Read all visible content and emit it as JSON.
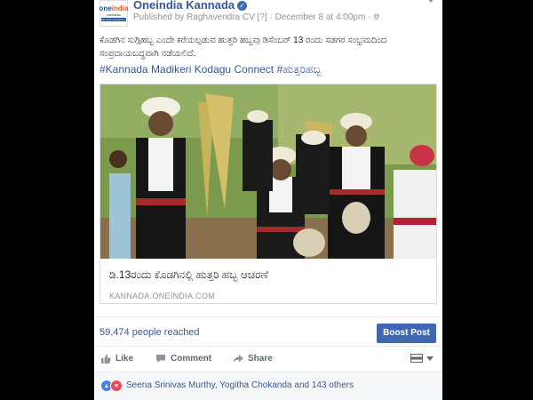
{
  "page": {
    "name": "Oneindia Kannada",
    "logo": {
      "text_a": "one",
      "text_b": "india",
      "sub": "kannada",
      "strip": "kannada.oneindia.com"
    }
  },
  "post": {
    "published_by": "Published by Raghavendra CV",
    "published_marker": "[?]",
    "separator": "·",
    "date": "December 8 at 4:00pm",
    "body": "ಕೊಡಗಿನ ಸುಗ್ಗಿಹಬ್ಬ ಎಂದೇ ಕರೆಯಲ್ಪಡುವ ಹುತ್ತರಿ ಹಬ್ಬವು ಡಿಸೆಂಬರ್ 13 ರಂದು ಸಡಗರ ಸಂಭ್ರಮದಿಂದ ಸಂಪ್ರದಾಯಬದ್ಧವಾಗಿ ನಡೆಯಲಿದೆ.",
    "hashtags": "#Kannada Madikeri Kodagu Connect #ಹುತ್ತರಿಹಬ್ಬ"
  },
  "link_preview": {
    "title": "ಡಿ.13ರಂದು ಕೊಡಗಿನಲ್ಲಿ ಹುತ್ತರಿ ಹಬ್ಬ ಆಚರಣೆ",
    "domain": "KANNADA.ONEINDIA.COM"
  },
  "stats": {
    "reach": "59,474 people reached",
    "boost_label": "Boost Post"
  },
  "actions": {
    "like": "Like",
    "comment": "Comment",
    "share": "Share"
  },
  "reactions": {
    "names": "Seena Srinivas Murthy, Yogitha Chokanda and 143 others"
  },
  "colors": {
    "link": "#365899",
    "boost": "#4267b2",
    "muted": "#90949c"
  },
  "icons": [
    "verified-icon",
    "globe-icon",
    "options-chevron-icon",
    "like-icon",
    "comment-icon",
    "share-icon",
    "viewer-flag-icon",
    "like-reaction-icon",
    "love-reaction-icon"
  ]
}
